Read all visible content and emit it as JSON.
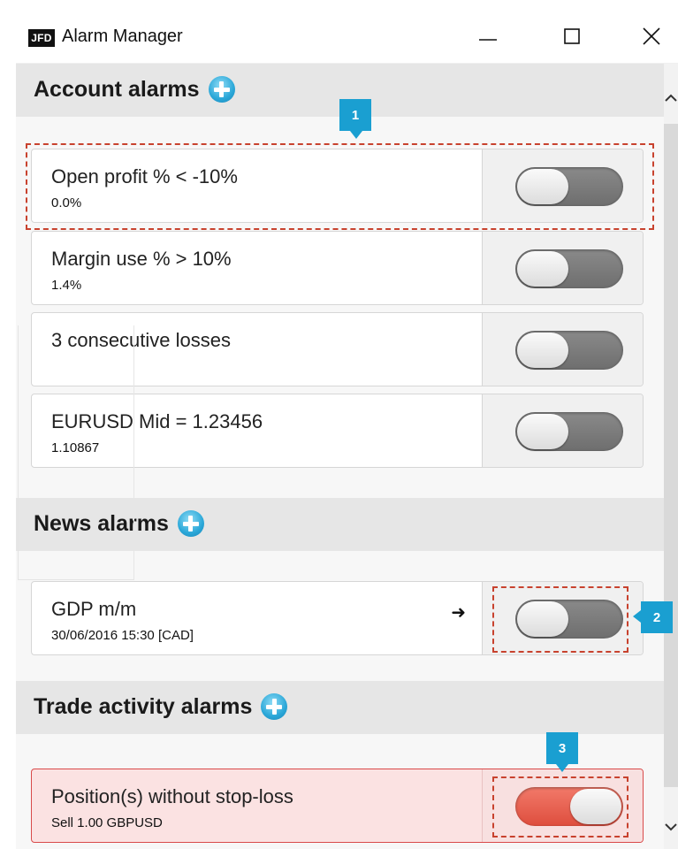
{
  "window": {
    "logo": "JFD",
    "title": "Alarm Manager"
  },
  "sections": {
    "account": {
      "title": "Account alarms",
      "alarms": [
        {
          "label": "Open profit % < -10%",
          "value": "0.0%",
          "enabled": false
        },
        {
          "label": "Margin use % > 10%",
          "value": "1.4%",
          "enabled": false
        },
        {
          "label": "3 consecutive losses",
          "value": "",
          "enabled": false
        },
        {
          "label": "EURUSD Mid = 1.23456",
          "value": "1.10867",
          "enabled": false
        }
      ]
    },
    "news": {
      "title": "News alarms",
      "alarms": [
        {
          "label": "GDP m/m",
          "value": "30/06/2016 15:30 [CAD]",
          "enabled": false
        }
      ]
    },
    "trade": {
      "title": "Trade activity alarms",
      "alarms": [
        {
          "label": "Position(s) without stop-loss",
          "value": "Sell 1.00 GBPUSD",
          "enabled": true
        }
      ]
    }
  },
  "callouts": [
    "1",
    "2",
    "3"
  ],
  "colors": {
    "accent": "#1a9fd1",
    "alert_bg": "#fbe2e2",
    "alert_border": "#d94a4a",
    "toggle_on": "#e55a4a",
    "annotation": "#c8422e"
  }
}
